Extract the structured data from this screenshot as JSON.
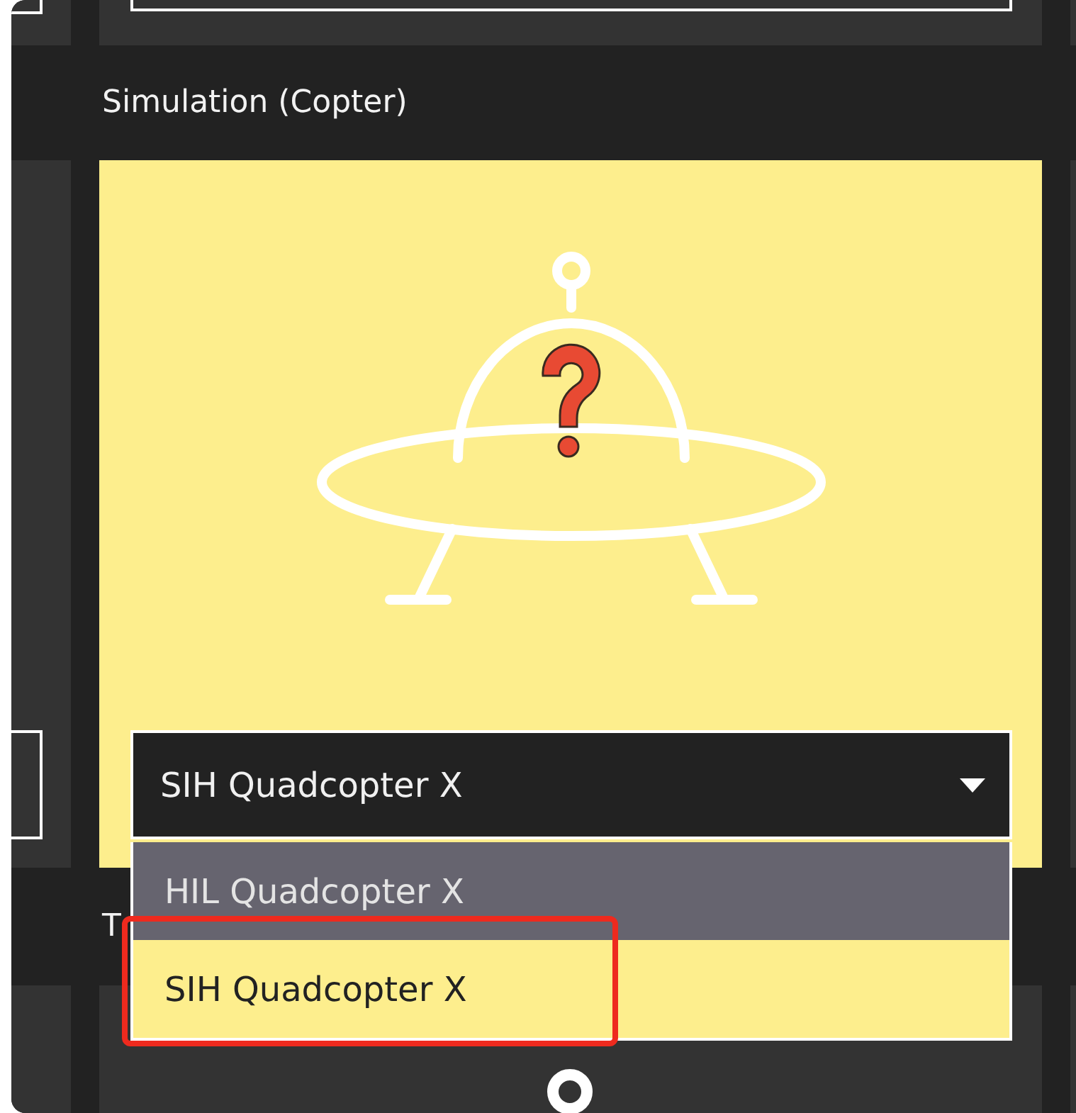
{
  "sections": [
    {
      "title": "Simulation (Copter)",
      "dropdown": {
        "value": "SIH Quadcopter X",
        "options": [
          {
            "label": "HIL Quadcopter X",
            "selected": false
          },
          {
            "label": "SIH Quadcopter X",
            "selected": true
          }
        ]
      }
    },
    {
      "title": "T"
    }
  ]
}
